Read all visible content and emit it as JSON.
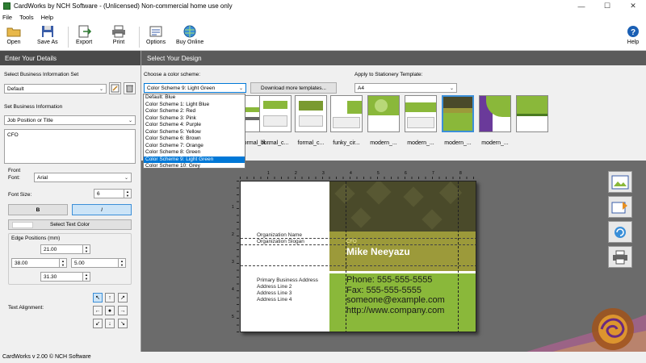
{
  "window": {
    "title": "CardWorks by NCH Software - (Unlicensed) Non-commercial home use only",
    "minimize": "—",
    "maximize": "☐",
    "close": "✕"
  },
  "menu": [
    "File",
    "Tools",
    "Help"
  ],
  "toolbar": {
    "open": "Open",
    "save_as": "Save As",
    "export": "Export",
    "print": "Print",
    "options": "Options",
    "buy_online": "Buy Online",
    "help": "Help"
  },
  "left": {
    "header": "Enter Your Details",
    "business_set_label": "Select Business Information Set",
    "business_set_value": "Default",
    "set_info_label": "Set Business Information",
    "info_field_value": "Job Position or Title",
    "info_text": "CFO",
    "front_label": "Front",
    "font_label": "Font:",
    "font_value": "Arial",
    "font_size_label": "Font Size:",
    "font_size_value": "6",
    "bold": "B",
    "italic": "I",
    "text_color": "Select Text Color",
    "edge_label": "Edge Positions (mm)",
    "edge_top": "21.00",
    "edge_left": "38.00",
    "edge_right": "5.00",
    "edge_bottom": "31.30",
    "alignment_label": "Text Alignment:"
  },
  "right": {
    "header": "Select Your Design",
    "scheme_label": "Choose a color scheme:",
    "scheme_value": "Color Scheme 9: Light Green",
    "download": "Download more templates...",
    "apply_label": "Apply to Stationery Template:",
    "apply_value": "A4"
  },
  "schemes": [
    "Default: Blue",
    "Color Scheme 1: Light Blue",
    "Color Scheme 2: Red",
    "Color Scheme 3: Pink",
    "Color Scheme 4: Purple",
    "Color Scheme 5: Yellow",
    "Color Scheme 6: Brown",
    "Color Scheme 7: Orange",
    "Color Scheme 8: Green",
    "Color Scheme 9: Light Green",
    "Color Scheme 10: Grey"
  ],
  "thumbnails": [
    "formal_bl...",
    "formal_c...",
    "formal_c...",
    "funky_cir...",
    "modern_...",
    "modern_...",
    "modern_...",
    "modern_..."
  ],
  "card": {
    "org_name": "Organization Name",
    "org_slogan": "Organization Slogan",
    "address": [
      "Primary Business Address",
      "Address Line 2",
      "Address Line 3",
      "Address Line 4"
    ],
    "position": "CFO",
    "name": "Mike Neeyazu",
    "phone": "Phone: 555-555-5555",
    "fax": "Fax: 555-555-5555",
    "email": "someone@example.com",
    "web": "http://www.company.com"
  },
  "ruler": {
    "top": [
      "1",
      "2",
      "3",
      "4",
      "5",
      "6",
      "7",
      "8"
    ],
    "left": [
      "1",
      "2",
      "3",
      "4",
      "5"
    ]
  },
  "status": "CardWorks v 2.00 © NCH Software",
  "colors": {
    "olive_dark": "#4a4a2a",
    "olive_band": "#9c9a3a",
    "lime": "#8ab83a",
    "selection": "#0078d7"
  }
}
